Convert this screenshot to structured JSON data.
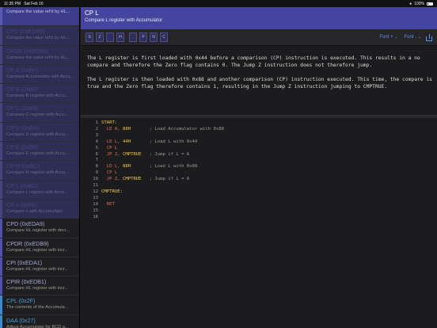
{
  "statusbar": {
    "time": "11:35 PM",
    "date": "Sat Feb 16",
    "battery": "100%"
  },
  "sidebar": {
    "items": [
      {
        "title": "",
        "desc": "Compare the value ref'd by HL...",
        "style": "active"
      },
      {
        "title": "CPD (0xEDB9)",
        "desc": "Compare the value ref'd by HL...",
        "style": "dim"
      },
      {
        "title": "CPDR (0xEDB9)",
        "desc": "Compare the value ref'd by HL...",
        "style": "dim"
      },
      {
        "title": "CP A (0xBF)",
        "desc": "Compare Accumulator with Accu...",
        "style": "dim"
      },
      {
        "title": "CP B (0xB8)",
        "desc": "Compare B register with Accu...",
        "style": "dim"
      },
      {
        "title": "CP C (0xB9)",
        "desc": "Compare C register with Accu...",
        "style": "dim"
      },
      {
        "title": "CP D (0xBA)",
        "desc": "Compare D register with Accu...",
        "style": "dim"
      },
      {
        "title": "CP E (0xBB)",
        "desc": "Compare E register with Accu...",
        "style": "dim"
      },
      {
        "title": "CP H (0xBC)",
        "desc": "Compare H register with Accu...",
        "style": "dim"
      },
      {
        "title": "CP L (0xBD)",
        "desc": "Compare L register with Accu...",
        "style": "dim"
      },
      {
        "title": "CP n (0xFE)",
        "desc": "Compare n with Accumulator",
        "style": "dim"
      },
      {
        "title": "CPD (0xEDA9)",
        "desc": "Compare HL register with decr...",
        "style": "normal"
      },
      {
        "title": "CPDR (0xEDB9)",
        "desc": "Compare HL register with incr...",
        "style": "normal"
      },
      {
        "title": "CPI (0xEDA1)",
        "desc": "Compare HL register with incr...",
        "style": "normal"
      },
      {
        "title": "CPIR (0xEDB1)",
        "desc": "Compare HL register with incr...",
        "style": "normal"
      },
      {
        "title": "CPL (0x2F)",
        "desc": "The contents of the Accumula...",
        "style": "cpl"
      },
      {
        "title": "DAA (0x27)",
        "desc": "Adjust Accumulator for BCD a...",
        "style": "daa"
      }
    ]
  },
  "header": {
    "title": "CP L",
    "subtitle": "Compare L register with Accumulator"
  },
  "toolbar": {
    "flags": [
      "S",
      "Z",
      "",
      "H",
      "",
      "P",
      "N",
      "C"
    ],
    "font_label_1": "Font +",
    "font_label_2": "Font -"
  },
  "explanation": {
    "p1": "The L register is first loaded with 0x44 before a comparison (CP) instruction is executed. This results in a no compare and therefore the Zero flag contains 0. The Jump Z instruction does not therefore jump.",
    "p2": "The L register is then loaded with 0x88 and another comparison (CP) instruction executed. This time, the compare is true and the Zero flag therefore contains 1, resulting in the Jump Z instruction jumping to CMPTRUE."
  },
  "code": [
    {
      "n": "1",
      "label": "START:",
      "op": "",
      "args": "",
      "comment": ""
    },
    {
      "n": "2",
      "label": "",
      "op": "LD A,",
      "args": "88H",
      "comment": "; Load Accumulator with 0x88"
    },
    {
      "n": "3",
      "label": "",
      "op": "",
      "args": "",
      "comment": ""
    },
    {
      "n": "4",
      "label": "",
      "op": "LD L,",
      "args": "44H",
      "comment": "; Load L with 0x44"
    },
    {
      "n": "5",
      "label": "",
      "op": "CP L",
      "args": "",
      "comment": ""
    },
    {
      "n": "6",
      "label": "",
      "op": "JP Z,",
      "args": "CMPTRUE",
      "comment": "; Jump if L = A"
    },
    {
      "n": "7",
      "label": "",
      "op": "",
      "args": "",
      "comment": ""
    },
    {
      "n": "8",
      "label": "",
      "op": "LD L,",
      "args": "88H",
      "comment": "; Load L with 0x88"
    },
    {
      "n": "9",
      "label": "",
      "op": "CP L",
      "args": "",
      "comment": ""
    },
    {
      "n": "10",
      "label": "",
      "op": "JP Z,",
      "args": "CMPTRUE",
      "comment": "; Jump if L = A"
    },
    {
      "n": "11",
      "label": "",
      "op": "",
      "args": "",
      "comment": ""
    },
    {
      "n": "12",
      "label": "CMPTRUE:",
      "op": "",
      "args": "",
      "comment": ""
    },
    {
      "n": "13",
      "label": "",
      "op": "",
      "args": "",
      "comment": ""
    },
    {
      "n": "14",
      "label": "",
      "op": "RET",
      "args": "",
      "comment": ""
    },
    {
      "n": "15",
      "label": "",
      "op": "",
      "args": "",
      "comment": ""
    },
    {
      "n": "16",
      "label": "",
      "op": "",
      "args": "",
      "comment": ""
    }
  ]
}
